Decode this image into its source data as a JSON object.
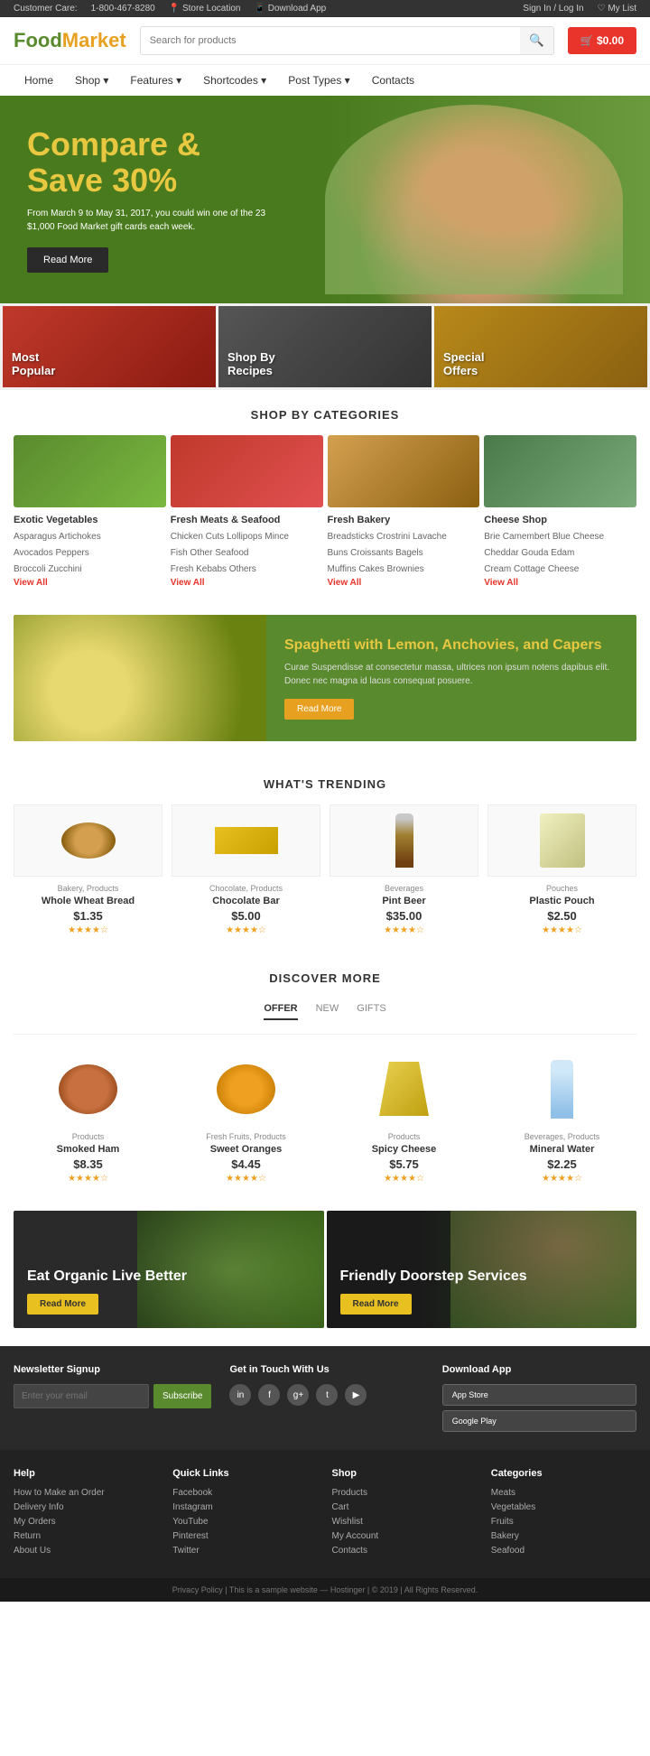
{
  "topbar": {
    "customer_care_label": "Customer Care:",
    "phone": "1-800-467-8280",
    "store_location": "Store Location",
    "download_app": "Download App",
    "sign_in": "Sign In / Log In",
    "my_list": "My List"
  },
  "header": {
    "logo_food": "Food",
    "logo_market": "Market",
    "search_placeholder": "Search for products",
    "cart_label": "$0.00"
  },
  "nav": {
    "items": [
      {
        "label": "Home",
        "has_dropdown": false
      },
      {
        "label": "Shop",
        "has_dropdown": true
      },
      {
        "label": "Features",
        "has_dropdown": true
      },
      {
        "label": "Shortcodes",
        "has_dropdown": true
      },
      {
        "label": "Post Types",
        "has_dropdown": true
      },
      {
        "label": "Contacts",
        "has_dropdown": false
      }
    ]
  },
  "hero": {
    "title": "Compare & Save 30%",
    "description": "From March 9 to May 31, 2017, you could win one of the 23 $1,000 Food Market gift cards each week.",
    "button_label": "Read More"
  },
  "feature_boxes": [
    {
      "label_line1": "Most",
      "label_line2": "Popular"
    },
    {
      "label_line1": "Shop By",
      "label_line2": "Recipes"
    },
    {
      "label_line1": "Special",
      "label_line2": "Offers"
    }
  ],
  "categories_section": {
    "title": "SHOP BY CATEGORIES",
    "items": [
      {
        "name": "Exotic Vegetables",
        "links": [
          "Asparagus Artichokes",
          "Avocados Peppers",
          "Broccoli Zucchini"
        ],
        "view_all": "View All"
      },
      {
        "name": "Fresh Meats & Seafood",
        "links": [
          "Chicken Cuts Lollipops Mince",
          "Fish Other Seafood",
          "Fresh Kebabs Others"
        ],
        "view_all": "View All"
      },
      {
        "name": "Fresh Bakery",
        "links": [
          "Breadsticks Crostrini Lavache",
          "Buns Croissants Bagels",
          "Muffins Cakes Brownies"
        ],
        "view_all": "View All"
      },
      {
        "name": "Cheese Shop",
        "links": [
          "Brie Camembert Blue Cheese",
          "Cheddar Gouda Edam",
          "Cream Cottage Cheese"
        ],
        "view_all": "View All"
      }
    ]
  },
  "recipe_banner": {
    "title": "Spaghetti with Lemon, Anchovies, and Capers",
    "description": "Curae Suspendisse at consectetur massa, ultrices non ipsum notens dapibus elit. Donec nec magna id lacus consequat posuere.",
    "button_label": "Read More"
  },
  "trending_section": {
    "title": "WHAT'S TRENDING",
    "products": [
      {
        "category": "Bakery, Products",
        "name": "Whole Wheat Bread",
        "price": "$1.35",
        "rating": 4
      },
      {
        "category": "Chocolate, Products",
        "name": "Chocolate Bar",
        "price": "$5.00",
        "rating": 4
      },
      {
        "category": "Beverages",
        "name": "Pint Beer",
        "price": "$35.00",
        "rating": 4
      },
      {
        "category": "Pouches",
        "name": "Plastic Pouch",
        "price": "$2.50",
        "rating": 4
      }
    ]
  },
  "discover_section": {
    "title": "DISCOVER MORE",
    "tabs": [
      {
        "label": "OFFER",
        "active": true
      },
      {
        "label": "NEW",
        "active": false
      },
      {
        "label": "GIFTS",
        "active": false
      }
    ],
    "products": [
      {
        "category": "Products",
        "name": "Smoked Ham",
        "price": "$8.35",
        "rating": 4
      },
      {
        "category": "Fresh Fruits, Products",
        "name": "Sweet Oranges",
        "price": "$4.45",
        "rating": 4
      },
      {
        "category": "Products",
        "name": "Spicy Cheese",
        "price": "$5.75",
        "rating": 4
      },
      {
        "category": "Beverages, Products",
        "name": "Mineral Water",
        "price": "$2.25",
        "rating": 4
      }
    ]
  },
  "promo_banners": [
    {
      "title": "Eat Organic Live Better",
      "button_label": "Read More"
    },
    {
      "title": "Friendly Doorstep Services",
      "button_label": "Read More"
    }
  ],
  "footer_top": {
    "newsletter": {
      "title": "Newsletter Signup",
      "placeholder": "Enter your email",
      "button_label": "Subscribe"
    },
    "contact": {
      "title": "Get in Touch With Us",
      "social_icons": [
        "in",
        "f",
        "g+",
        "t",
        "yt"
      ]
    },
    "download": {
      "title": "Download App",
      "app_store": "App Store",
      "google_play": "Google Play"
    }
  },
  "footer_links": {
    "columns": [
      {
        "title": "Help",
        "links": [
          "How to Make an Order",
          "Delivery Info",
          "My Orders",
          "Return",
          "About Us"
        ]
      },
      {
        "title": "Quick Links",
        "links": [
          "Facebook",
          "Instagram",
          "YouTube",
          "Pinterest",
          "Twitter"
        ]
      },
      {
        "title": "Shop",
        "links": [
          "Products",
          "Cart",
          "Wishlist",
          "My Account",
          "Contacts"
        ]
      },
      {
        "title": "Categories",
        "links": [
          "Meats",
          "Vegetables",
          "Fruits",
          "Bakery",
          "Seafood"
        ]
      }
    ]
  },
  "footer_bottom": {
    "text": "Privacy Policy | This is a sample website — Hostinger | © 2019 | All Rights Reserved."
  }
}
